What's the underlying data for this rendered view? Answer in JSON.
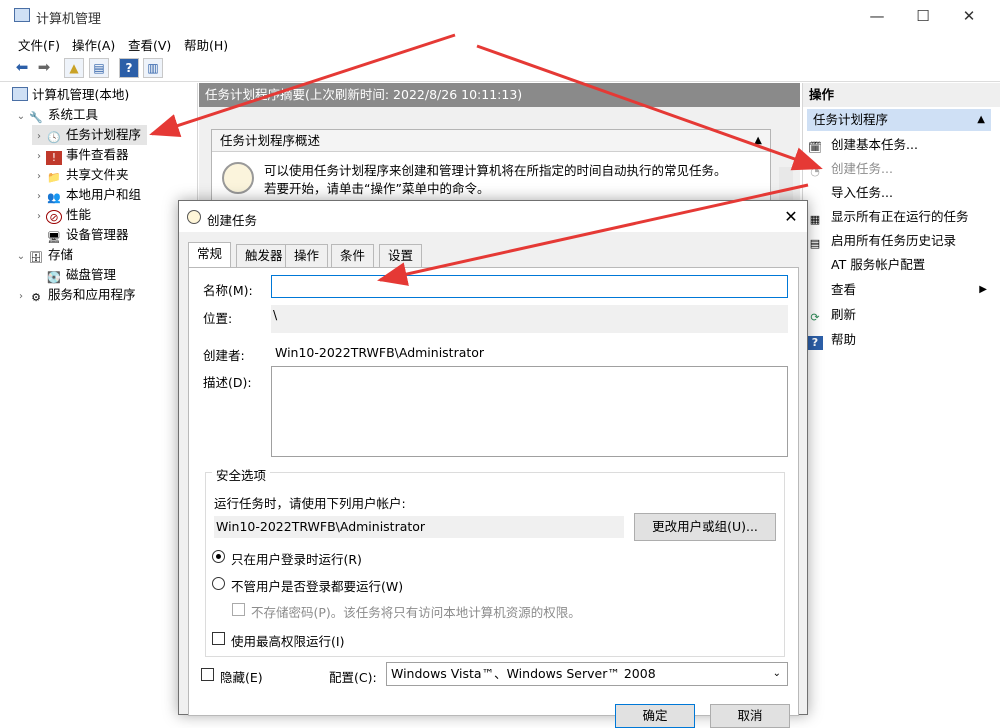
{
  "window": {
    "title": "计算机管理",
    "minimize": "—",
    "maximize": "☐",
    "close": "✕"
  },
  "menu": [
    "文件(F)",
    "操作(A)",
    "查看(V)",
    "帮助(H)"
  ],
  "tree": {
    "root": "计算机管理(本地)",
    "system_tools": "系统工具",
    "task_scheduler": "任务计划程序",
    "event_viewer": "事件查看器",
    "shared_folders": "共享文件夹",
    "local_users": "本地用户和组",
    "performance": "性能",
    "device_manager": "设备管理器",
    "storage": "存储",
    "disk_management": "磁盘管理",
    "services_apps": "服务和应用程序"
  },
  "center": {
    "header": "任务计划程序摘要(上次刷新时间: 2022/8/26 10:11:13)",
    "overview_title": "任务计划程序概述",
    "overview_text": "可以使用任务计划程序来创建和管理计算机将在所指定的时间自动执行的常见任务。若要开始，请单击“操作”菜单中的命令。"
  },
  "actions": {
    "header": "操作",
    "section": "任务计划程序",
    "items": [
      "创建基本任务...",
      "创建任务...",
      "导入任务...",
      "显示所有正在运行的任务",
      "启用所有任务历史记录",
      "AT 服务帐户配置",
      "查看",
      "刷新",
      "帮助"
    ]
  },
  "dialog": {
    "title": "创建任务",
    "tabs": [
      "常规",
      "触发器",
      "操作",
      "条件",
      "设置"
    ],
    "name_label": "名称(M):",
    "name_value": "",
    "location_label": "位置:",
    "location_value": "\\",
    "author_label": "创建者:",
    "author_value": "Win10-2022TRWFB\\Administrator",
    "description_label": "描述(D):",
    "security_title": "安全选项",
    "run_as_label": "运行任务时，请使用下列用户帐户:",
    "run_as_value": "Win10-2022TRWFB\\Administrator",
    "change_user_button": "更改用户或组(U)...",
    "radio_logged_on": "只在用户登录时运行(R)",
    "radio_whether": "不管用户是否登录都要运行(W)",
    "no_store_password": "不存储密码(P)。该任务将只有访问本地计算机资源的权限。",
    "highest_privileges": "使用最高权限运行(I)",
    "hidden_label": "隐藏(E)",
    "configure_label": "配置(C):",
    "configure_value": "Windows Vista™、Windows Server™ 2008",
    "ok_button": "确定",
    "cancel_button": "取消"
  },
  "colors": {
    "annotation_arrow": "#e53935",
    "selection": "#cfe0f5",
    "header_gray": "#8a8a8a"
  }
}
